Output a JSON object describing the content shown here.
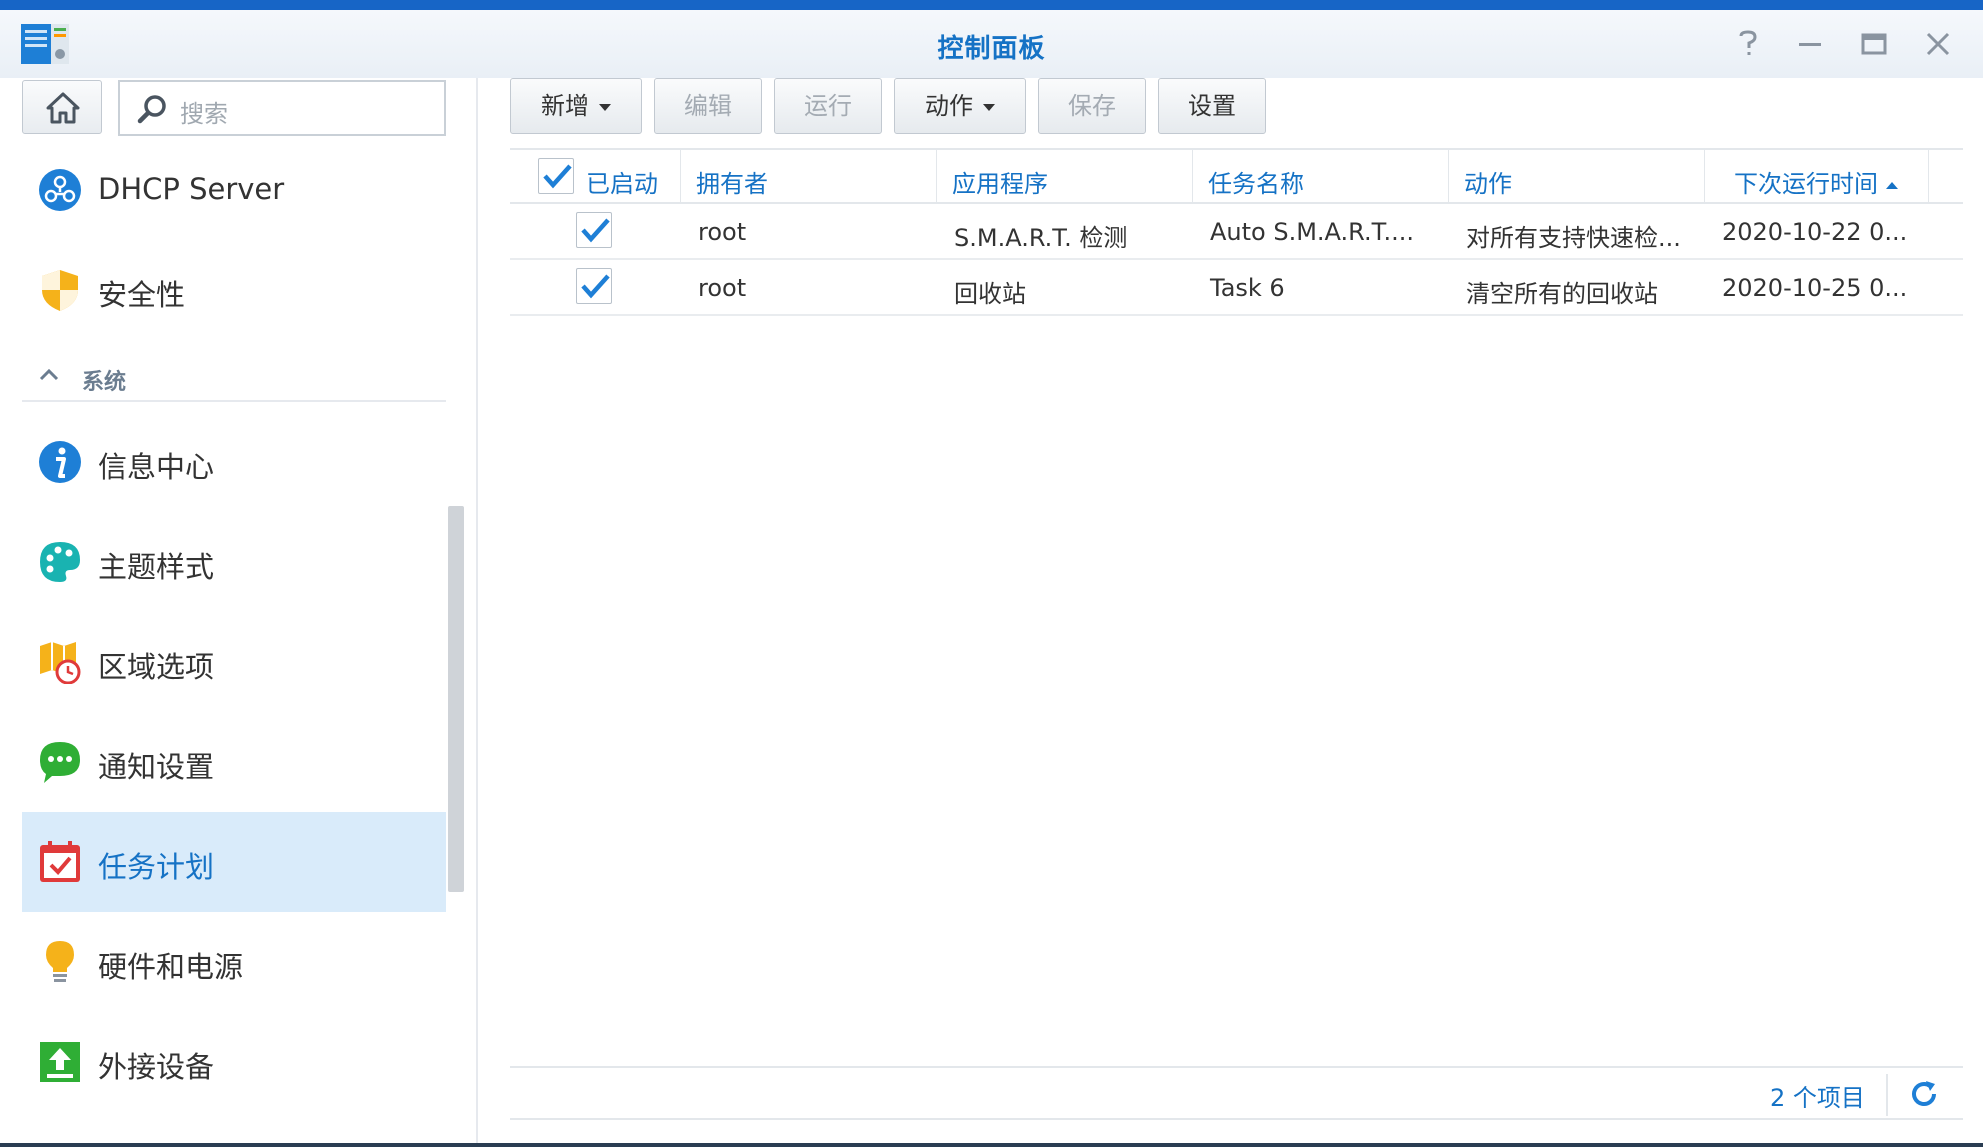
{
  "window": {
    "title": "控制面板"
  },
  "sidebar": {
    "search_placeholder": "搜索",
    "items_top": [
      {
        "label": "DHCP Server",
        "icon": "dhcp-server-icon"
      },
      {
        "label": "安全性",
        "icon": "shield-icon"
      }
    ],
    "section": {
      "label": "系统"
    },
    "items": [
      {
        "label": "信息中心",
        "icon": "info-icon"
      },
      {
        "label": "主题样式",
        "icon": "palette-icon"
      },
      {
        "label": "区域选项",
        "icon": "region-clock-icon"
      },
      {
        "label": "通知设置",
        "icon": "chat-bubble-icon"
      },
      {
        "label": "任务计划",
        "icon": "calendar-check-icon",
        "selected": true
      },
      {
        "label": "硬件和电源",
        "icon": "lightbulb-icon"
      },
      {
        "label": "外接设备",
        "icon": "upload-icon"
      }
    ]
  },
  "toolbar": {
    "add": "新增",
    "edit": "编辑",
    "run": "运行",
    "action": "动作",
    "save": "保存",
    "settings": "设置"
  },
  "grid": {
    "columns": {
      "enabled": "已启动",
      "owner": "拥有者",
      "app": "应用程序",
      "task": "任务名称",
      "action": "动作",
      "next_run": "下次运行时间"
    },
    "rows": [
      {
        "enabled": true,
        "owner": "root",
        "app": "S.M.A.R.T. 检测",
        "task": "Auto S.M.A.R.T....",
        "action": "对所有支持快速检...",
        "next_run": "2020-10-22 0..."
      },
      {
        "enabled": true,
        "owner": "root",
        "app": "回收站",
        "task": "Task 6",
        "action": "清空所有的回收站",
        "next_run": "2020-10-25 0..."
      }
    ]
  },
  "footer": {
    "count": "2 个项目"
  },
  "colors": {
    "accent": "#1572c5",
    "selected_bg": "#d9ebfa",
    "titlebar_top": "#1765c6"
  }
}
